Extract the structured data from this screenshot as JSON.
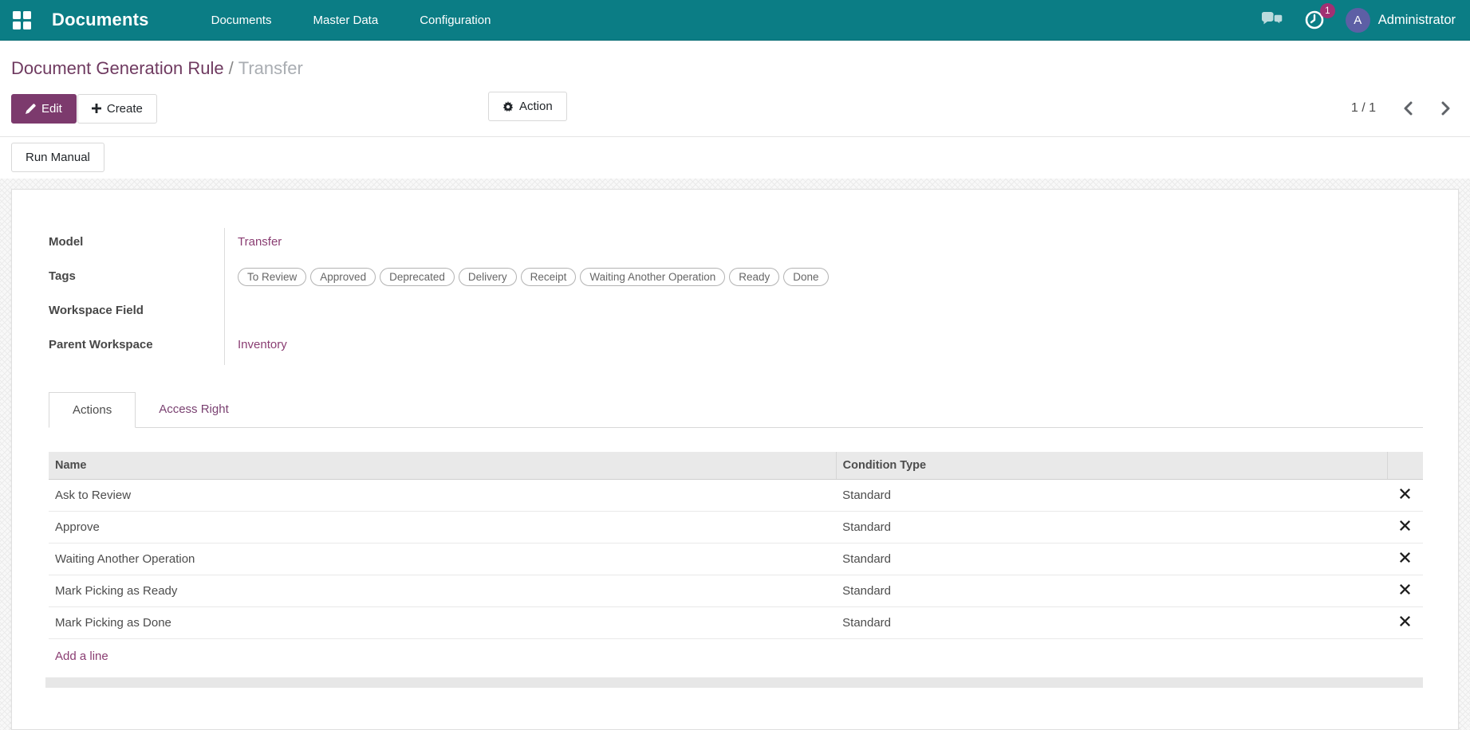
{
  "navbar": {
    "app_title": "Documents",
    "menu": [
      "Documents",
      "Master Data",
      "Configuration"
    ],
    "activity_badge": "1",
    "avatar_initial": "A",
    "user_name": "Administrator"
  },
  "breadcrumb": {
    "parent": "Document Generation Rule",
    "separator": "/",
    "current": "Transfer"
  },
  "control_panel": {
    "edit": "Edit",
    "create": "Create",
    "action": "Action",
    "pager": "1 / 1"
  },
  "statusbar": {
    "run_manual": "Run Manual"
  },
  "form": {
    "model_label": "Model",
    "model_value": "Transfer",
    "tags_label": "Tags",
    "tags": [
      "To Review",
      "Approved",
      "Deprecated",
      "Delivery",
      "Receipt",
      "Waiting Another Operation",
      "Ready",
      "Done"
    ],
    "workspace_field_label": "Workspace Field",
    "workspace_field_value": "",
    "parent_workspace_label": "Parent Workspace",
    "parent_workspace_value": "Inventory"
  },
  "tabs": {
    "actions": "Actions",
    "access_right": "Access Right"
  },
  "actions_table": {
    "columns": [
      "Name",
      "Condition Type"
    ],
    "rows": [
      {
        "name": "Ask to Review",
        "condition": "Standard"
      },
      {
        "name": "Approve",
        "condition": "Standard"
      },
      {
        "name": "Waiting Another Operation",
        "condition": "Standard"
      },
      {
        "name": "Mark Picking as Ready",
        "condition": "Standard"
      },
      {
        "name": "Mark Picking as Done",
        "condition": "Standard"
      }
    ],
    "add_line": "Add a line"
  },
  "colors": {
    "navbar_teal": "#0b7d85",
    "primary_purple": "#7c3a6d",
    "link_purple": "#8a3d72",
    "badge_magenta": "#a23073",
    "avatar_indigo": "#5d5fa5"
  }
}
